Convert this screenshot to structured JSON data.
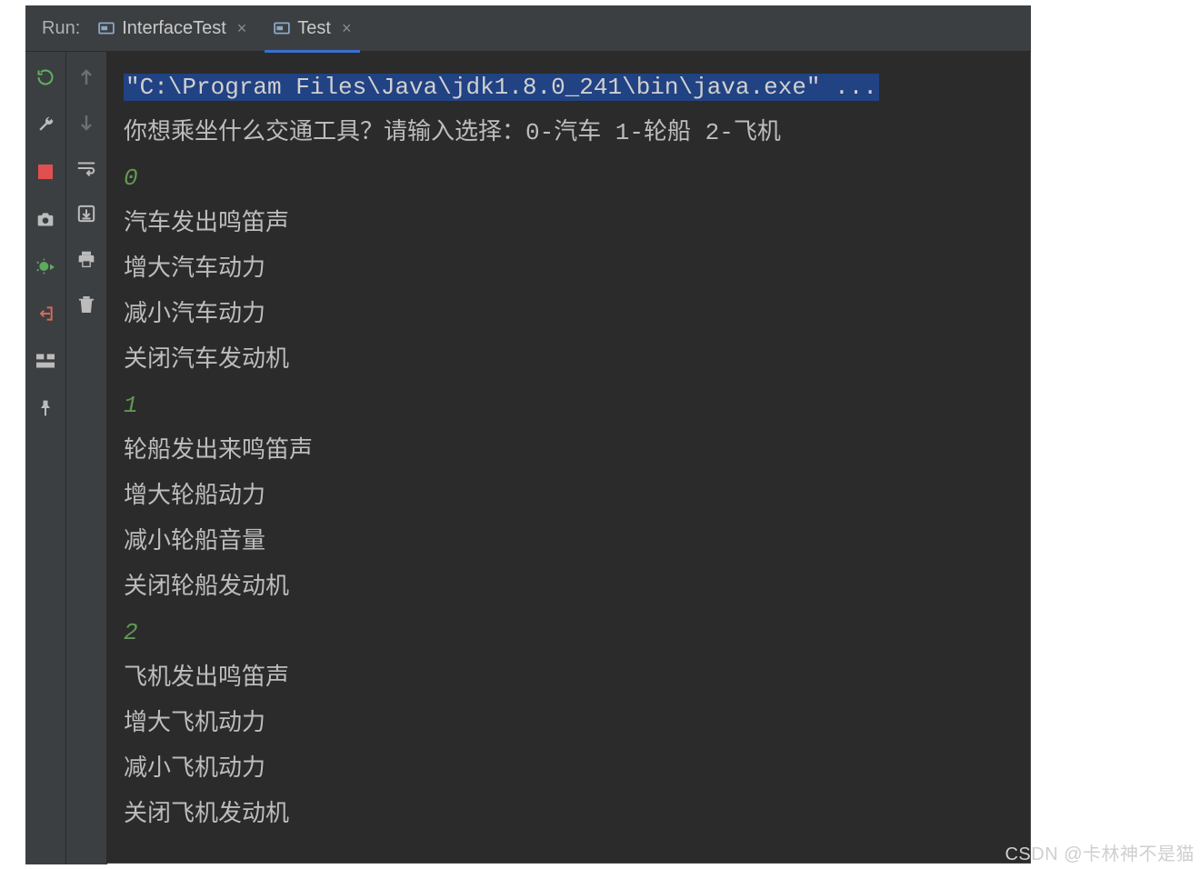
{
  "header": {
    "run_label": "Run:",
    "tabs": [
      {
        "label": "InterfaceTest",
        "active": false
      },
      {
        "label": "Test",
        "active": true
      }
    ],
    "close_glyph": "×"
  },
  "toolbar_col1_icons": [
    "rerun",
    "wrench",
    "stop",
    "camera",
    "bug-run",
    "exit",
    "layout",
    "pin"
  ],
  "toolbar_col2_icons": [
    "arrow-up",
    "arrow-down",
    "soft-wrap",
    "scroll-to-end",
    "print",
    "trash"
  ],
  "console": {
    "command": "\"C:\\Program Files\\Java\\jdk1.8.0_241\\bin\\java.exe\" ...",
    "prompt": "你想乘坐什么交通工具？请输入选择：0-汽车 1-轮船 2-飞机",
    "sections": [
      {
        "input": "0",
        "lines": [
          "汽车发出鸣笛声",
          "增大汽车动力",
          "减小汽车动力",
          "关闭汽车发动机"
        ]
      },
      {
        "input": "1",
        "lines": [
          "轮船发出来鸣笛声",
          "增大轮船动力",
          "减小轮船音量",
          "关闭轮船发动机"
        ]
      },
      {
        "input": "2",
        "lines": [
          "飞机发出鸣笛声",
          "增大飞机动力",
          "减小飞机动力",
          "关闭飞机发动机"
        ]
      }
    ]
  },
  "watermark": "CSDN @卡林神不是猫"
}
